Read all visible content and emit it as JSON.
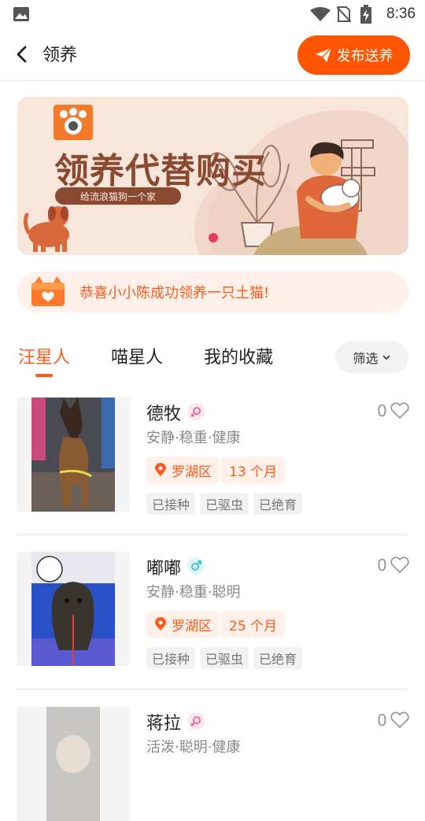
{
  "status_bar": {
    "time": "8:36"
  },
  "header": {
    "title": "领养",
    "publish_label": "发布送养"
  },
  "banner": {
    "title": "领养代替购买",
    "subtitle": "给流浪猫狗一个家"
  },
  "notice": {
    "text": "恭喜小小陈成功领养一只土猫!"
  },
  "tabs": [
    {
      "label": "汪星人",
      "active": true
    },
    {
      "label": "喵星人",
      "active": false
    },
    {
      "label": "我的收藏",
      "active": false
    }
  ],
  "filter": {
    "label": "筛选"
  },
  "pets": [
    {
      "name": "德牧",
      "gender": "female",
      "traits": "安静·稳重·健康",
      "location": "罗湖区",
      "age": "13 个月",
      "tags": [
        "已接种",
        "已驱虫",
        "已绝育"
      ],
      "likes": "0"
    },
    {
      "name": "嘟嘟",
      "gender": "male",
      "traits": "安静·稳重·聪明",
      "location": "罗湖区",
      "age": "25 个月",
      "tags": [
        "已接种",
        "已驱虫",
        "已绝育"
      ],
      "likes": "0"
    },
    {
      "name": "蒋拉",
      "gender": "female",
      "traits": "活泼·聪明·健康",
      "likes": "0"
    }
  ],
  "colors": {
    "accent": "#ff5a1a",
    "button": "#ff5400",
    "banner_bg": "#f8e6da",
    "banner_text": "#8a4a32"
  }
}
